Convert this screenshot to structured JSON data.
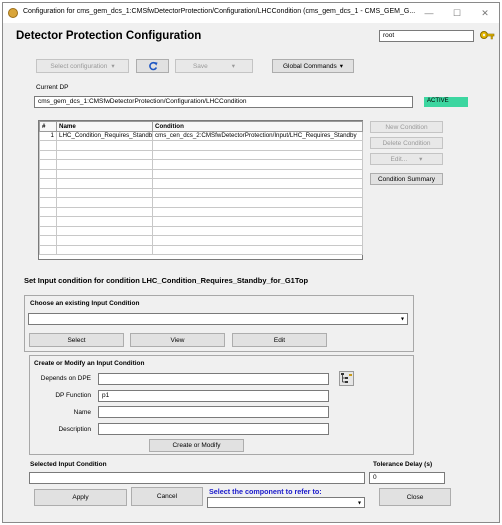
{
  "window": {
    "title": "Configuration for cms_gem_dcs_1:CMSfwDetectorProtection/Configuration/LHCCondition (cms_gem_dcs_1 - CMS_GEM_G..."
  },
  "header": {
    "title": "Detector Protection Configuration",
    "user": "root"
  },
  "toolbar": {
    "select_configuration": "Select configuration",
    "save": "Save",
    "global_commands": "Global Commands"
  },
  "current_dp": {
    "label": "Current DP",
    "value": "cms_gem_dcs_1:CMSfwDetectorProtection/Configuration/LHCCondition",
    "status": "ACTIVE"
  },
  "table": {
    "columns": [
      "#",
      "Name",
      "Condition"
    ],
    "rows": [
      {
        "index": "1",
        "name": "LHC_Condition_Requires_Standby",
        "condition": "cms_cen_dcs_2:CMSfwDetectorProtection/Input/LHC_Requires_Standby"
      }
    ]
  },
  "side_buttons": {
    "new_condition": "New Condition",
    "delete_condition": "Delete Condition",
    "edit": "Edit...",
    "condition_summary": "Condition Summary"
  },
  "input_section": {
    "title": "Set Input condition for condition LHC_Condition_Requires_Standby_for_G1Top",
    "choose_title": "Choose an existing Input Condition",
    "select_value": "",
    "select_btn": "Select",
    "view_btn": "View",
    "edit_btn": "Edit"
  },
  "create_section": {
    "title": "Create or Modify an Input Condition",
    "depends_label": "Depends on DPE",
    "depends_value": "",
    "dp_function_label": "DP Function",
    "dp_function_value": "p1",
    "name_label": "Name",
    "name_value": "",
    "description_label": "Description",
    "description_value": "",
    "create_btn": "Create or Modify"
  },
  "footer": {
    "selected_label": "Selected Input Condition",
    "selected_value": "",
    "tolerance_label": "Tolerance Delay (s)",
    "tolerance_value": "0",
    "apply": "Apply",
    "cancel": "Cancel",
    "component_label": "Select the component to refer to:",
    "component_value": "",
    "close": "Close"
  },
  "colors": {
    "status_active": "#3cd6a0",
    "link_blue": "#1a1acc"
  }
}
